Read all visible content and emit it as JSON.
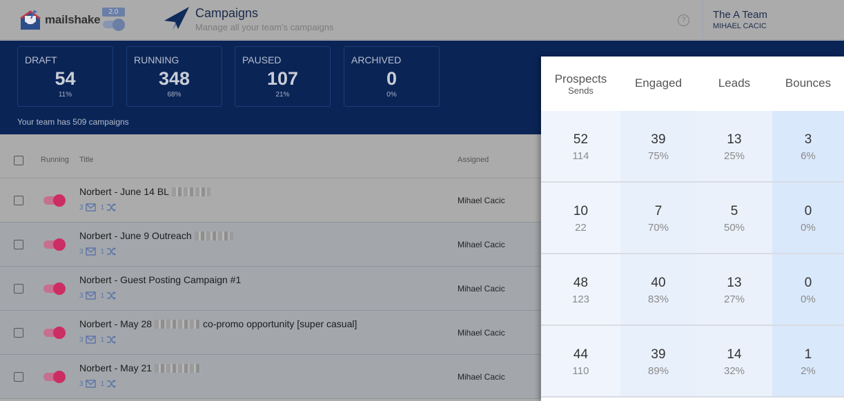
{
  "header": {
    "brand": "mailshake",
    "version_badge": "2.0",
    "title": "Campaigns",
    "subtitle": "Manage all your team's campaigns",
    "help_icon": "question-circle-icon",
    "team_name": "The A Team",
    "user_name": "MIHAEL CACIC"
  },
  "stats": {
    "cards": [
      {
        "label": "DRAFT",
        "value": "54",
        "pct": "11%"
      },
      {
        "label": "RUNNING",
        "value": "348",
        "pct": "68%"
      },
      {
        "label": "PAUSED",
        "value": "107",
        "pct": "21%"
      },
      {
        "label": "ARCHIVED",
        "value": "0",
        "pct": "0%"
      }
    ],
    "footer": "Your team has 509 campaigns"
  },
  "list": {
    "columns": {
      "running": "Running",
      "title": "Title",
      "assigned": "Assigned"
    },
    "rows": [
      {
        "title_a": "Norbert - June 14 BL",
        "redacted": true,
        "title_b": "",
        "messages": "3",
        "variants": "1",
        "assigned": "Mihael Cacic",
        "running": true
      },
      {
        "title_a": "Norbert - June 9 Outreach",
        "redacted": true,
        "title_b": "",
        "messages": "3",
        "variants": "1",
        "assigned": "Mihael Cacic",
        "running": true
      },
      {
        "title_a": "Norbert - Guest Posting Campaign #1",
        "redacted": false,
        "title_b": "",
        "messages": "3",
        "variants": "1",
        "assigned": "Mihael Cacic",
        "running": true
      },
      {
        "title_a": "Norbert - May 28",
        "redacted": true,
        "title_b": "co-promo opportunity [super casual]",
        "messages": "3",
        "variants": "1",
        "assigned": "Mihael Cacic",
        "running": true
      },
      {
        "title_a": "Norbert - May 21",
        "redacted": true,
        "title_b": "",
        "messages": "3",
        "variants": "1",
        "assigned": "Mihael Cacic",
        "running": true
      }
    ]
  },
  "stats_panel": {
    "headers": [
      {
        "label": "Prospects",
        "sub": "Sends"
      },
      {
        "label": "Engaged",
        "sub": ""
      },
      {
        "label": "Leads",
        "sub": ""
      },
      {
        "label": "Bounces",
        "sub": ""
      }
    ],
    "rows": [
      [
        {
          "v": "52",
          "p": "114"
        },
        {
          "v": "39",
          "p": "75%"
        },
        {
          "v": "13",
          "p": "25%"
        },
        {
          "v": "3",
          "p": "6%"
        }
      ],
      [
        {
          "v": "10",
          "p": "22"
        },
        {
          "v": "7",
          "p": "70%"
        },
        {
          "v": "5",
          "p": "50%"
        },
        {
          "v": "0",
          "p": "0%"
        }
      ],
      [
        {
          "v": "48",
          "p": "123"
        },
        {
          "v": "40",
          "p": "83%"
        },
        {
          "v": "13",
          "p": "27%"
        },
        {
          "v": "0",
          "p": "0%"
        }
      ],
      [
        {
          "v": "44",
          "p": "110"
        },
        {
          "v": "39",
          "p": "89%"
        },
        {
          "v": "14",
          "p": "32%"
        },
        {
          "v": "1",
          "p": "2%"
        }
      ]
    ]
  },
  "colors": {
    "banner": "#0a2456",
    "toggle_on": "#cc2e63",
    "meta_blue": "#5a73a8"
  }
}
